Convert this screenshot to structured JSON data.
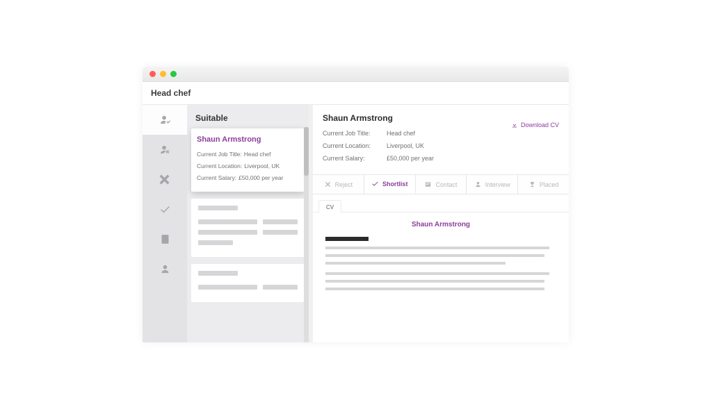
{
  "pageTitle": "Head chef",
  "listHeader": "Suitable",
  "candidate": {
    "name": "Shaun Armstrong",
    "jobTitleLabel": "Current Job Title:",
    "jobTitle": "Head chef",
    "locationLabel": "Current Location:",
    "location": "Liverpool, UK",
    "salaryLabel": "Current Salary:",
    "salary": "£50,000 per year"
  },
  "detail": {
    "name": "Shaun Armstrong",
    "jobTitleLabel": "Current Job Title:",
    "jobTitle": "Head chef",
    "locationLabel": "Current Location:",
    "location": "Liverpool, UK",
    "salaryLabel": "Current Salary:",
    "salary": "£50,000 per year",
    "downloadLabel": "Download CV"
  },
  "actions": {
    "reject": "Reject",
    "shortlist": "Shortlist",
    "contact": "Contact",
    "interview": "Interview",
    "placed": "Placed"
  },
  "cv": {
    "tabLabel": "CV",
    "title": "Shaun Armstrong"
  }
}
